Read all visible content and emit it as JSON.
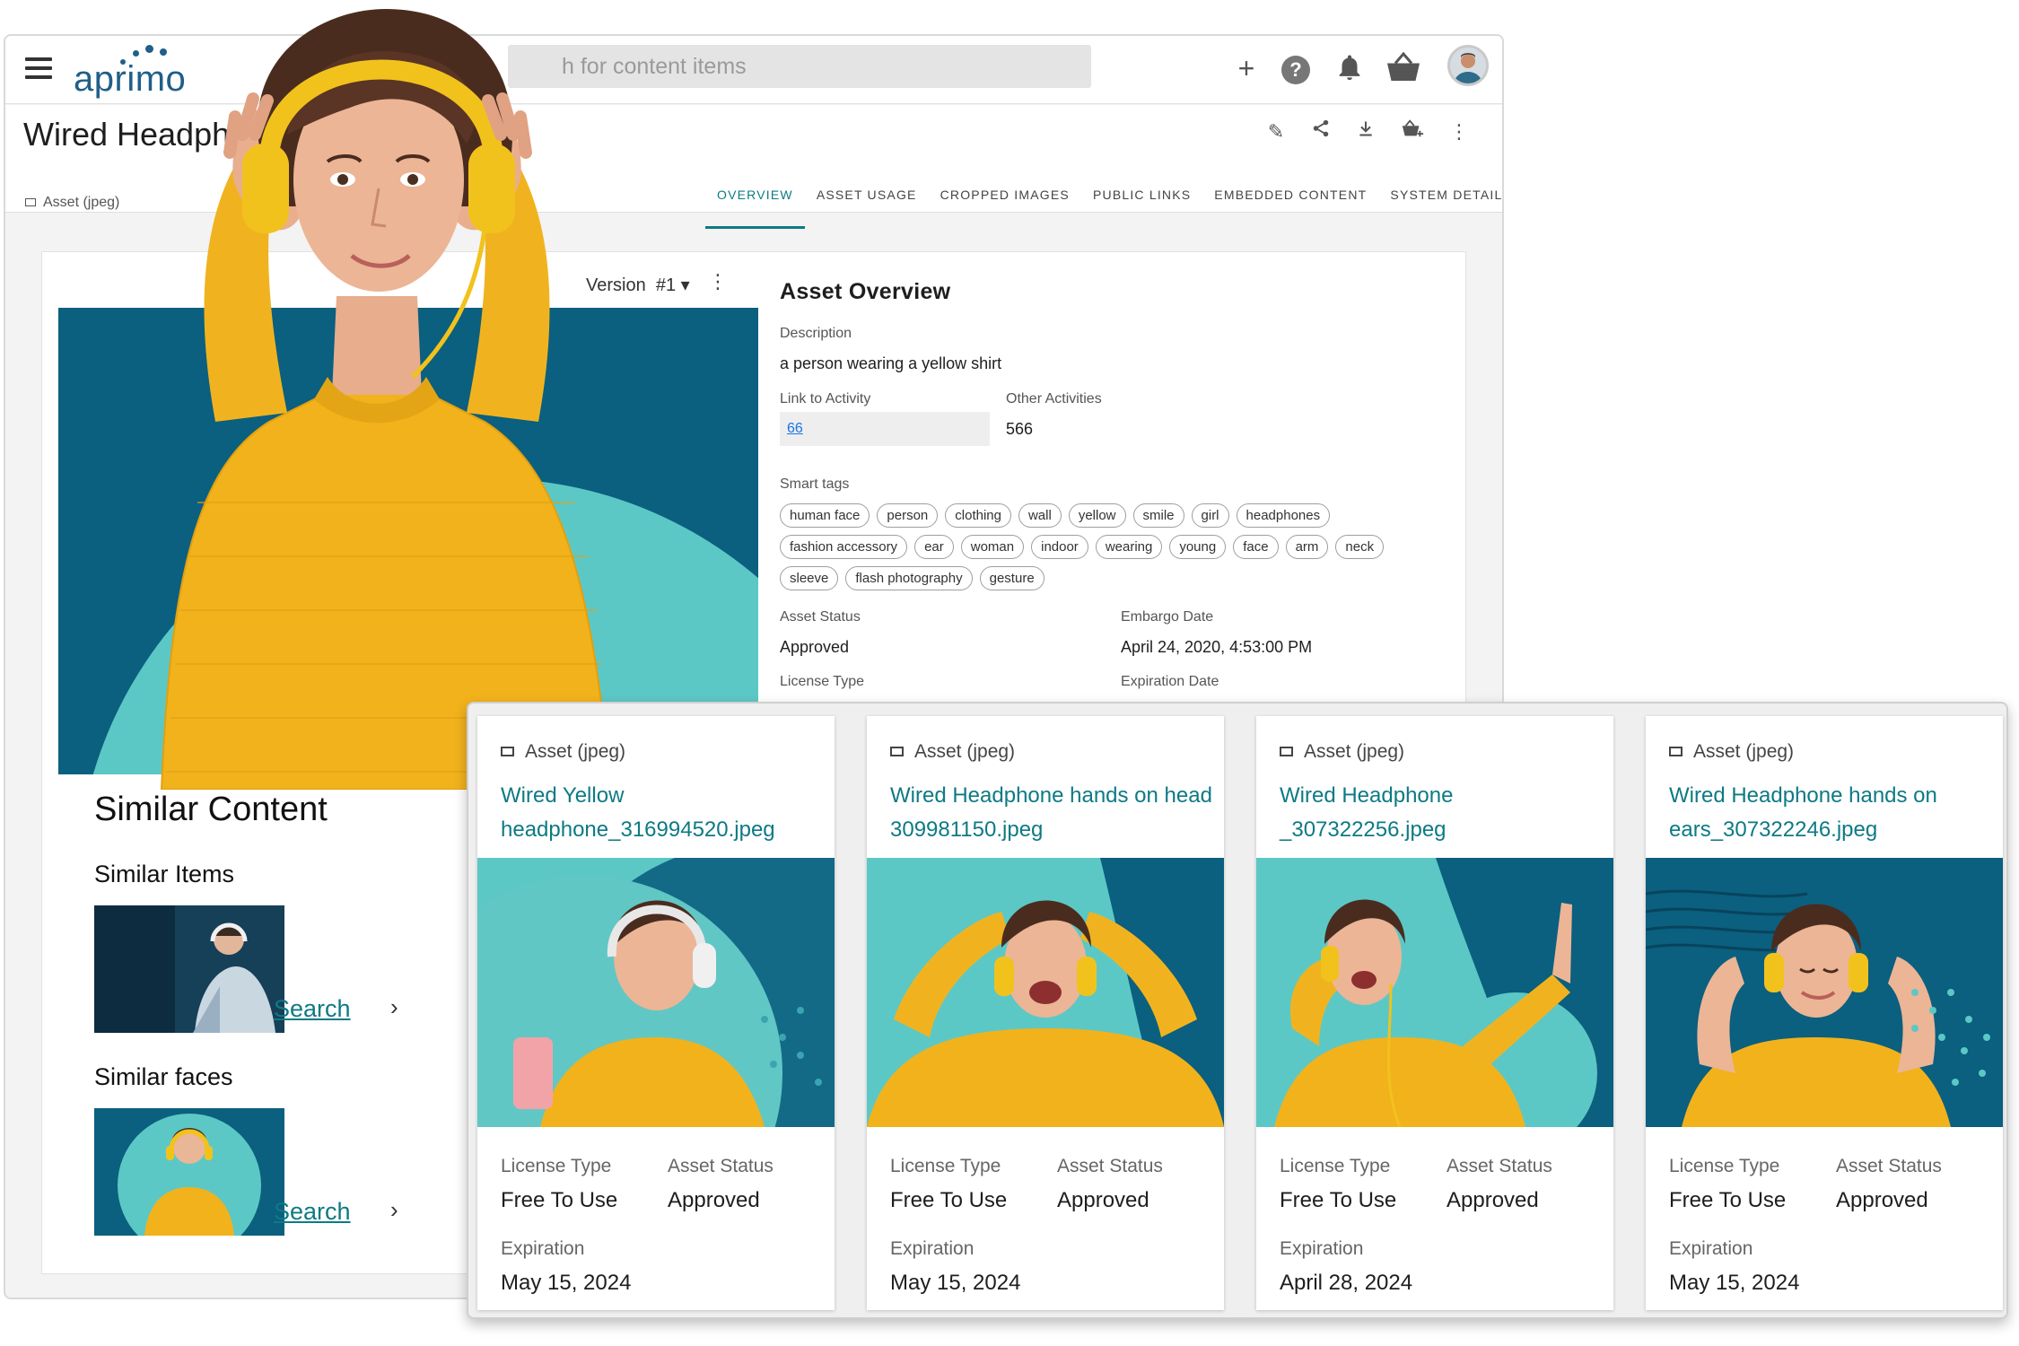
{
  "app": {
    "logo": "aprimo",
    "search_placeholder": "h for content items",
    "page_title": "Wired Headphone",
    "asset_type": "Asset (jpeg)"
  },
  "tabs": [
    "OVERVIEW",
    "ASSET USAGE",
    "CROPPED IMAGES",
    "PUBLIC LINKS",
    "EMBEDDED CONTENT",
    "SYSTEM DETAILS"
  ],
  "preview": {
    "version_label": "Version",
    "version_value": "#1"
  },
  "overview": {
    "title": "Asset Overview",
    "description_label": "Description",
    "description": "a person wearing a yellow shirt",
    "link_label": "Link to Activity",
    "link_value": "66",
    "other_label": "Other Activities",
    "other_value": "566",
    "tags_label": "Smart tags",
    "tags": [
      "human face",
      "person",
      "clothing",
      "wall",
      "yellow",
      "smile",
      "girl",
      "headphones",
      "fashion accessory",
      "ear",
      "woman",
      "indoor",
      "wearing",
      "young",
      "face",
      "arm",
      "neck",
      "sleeve",
      "flash photography",
      "gesture"
    ],
    "asset_status_label": "Asset Status",
    "asset_status": "Approved",
    "embargo_label": "Embargo Date",
    "embargo": "April 24, 2020, 4:53:00 PM",
    "license_label": "License Type",
    "expiration_label": "Expiration Date"
  },
  "similar": {
    "title": "Similar Content",
    "items_label": "Similar Items",
    "faces_label": "Similar faces",
    "search_label": "Search"
  },
  "cards": [
    {
      "type": "Asset (jpeg)",
      "title": "Wired Yellow headphone_316994520.jpeg",
      "license_label": "License Type",
      "license": "Free To Use",
      "status_label": "Asset Status",
      "status": "Approved",
      "exp_label": "Expiration",
      "exp": "May 15, 2024"
    },
    {
      "type": "Asset (jpeg)",
      "title": "Wired Headphone hands on head 309981150.jpeg",
      "license_label": "License Type",
      "license": "Free To Use",
      "status_label": "Asset Status",
      "status": "Approved",
      "exp_label": "Expiration",
      "exp": "May 15, 2024"
    },
    {
      "type": "Asset (jpeg)",
      "title": "Wired Headphone _307322256.jpeg",
      "license_label": "License Type",
      "license": "Free To Use",
      "status_label": "Asset Status",
      "status": "Approved",
      "exp_label": "Expiration",
      "exp": "April 28, 2024"
    },
    {
      "type": "Asset (jpeg)",
      "title": "Wired Headphone hands on ears_307322246.jpeg",
      "license_label": "License Type",
      "license": "Free To Use",
      "status_label": "Asset Status",
      "status": "Approved",
      "exp_label": "Expiration",
      "exp": "May 15, 2024"
    }
  ],
  "colors": {
    "teal": "#0d7a84",
    "navy": "#0b5f7f",
    "aqua": "#5cc8c6",
    "yellow": "#f2b21c"
  }
}
